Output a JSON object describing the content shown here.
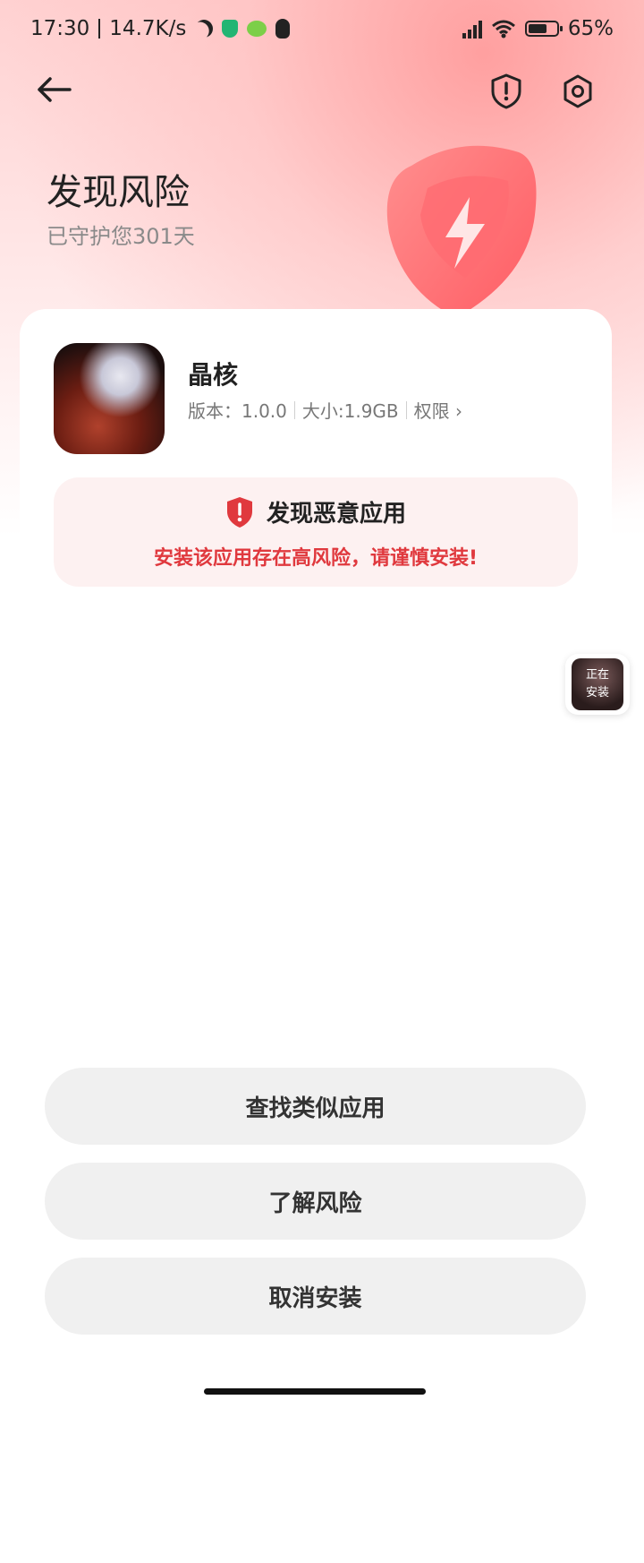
{
  "status_bar": {
    "time": "17:30",
    "net_speed": "14.7K/s",
    "battery": "65%",
    "icons": [
      "moon-icon",
      "shield-icon",
      "wechat-icon",
      "qq-icon",
      "hd-signal-icon",
      "wifi-icon",
      "battery-icon"
    ]
  },
  "header": {
    "back_icon": "arrow-left-icon",
    "right_icons": [
      "shield-alert-icon",
      "settings-gear-icon"
    ]
  },
  "hero": {
    "title": "发现风险",
    "subtitle": "已守护您301天"
  },
  "app": {
    "name": "晶核",
    "version": "版本：1.0.0",
    "size": "大小:1.9GB",
    "permissions": "权限"
  },
  "warning": {
    "title": "发现恶意应用",
    "description": "安装该应用存在高风险，请谨慎安装!",
    "color": "#e0393e"
  },
  "floating": {
    "line1": "正在",
    "line2": "安装"
  },
  "actions": {
    "find_similar": "查找类似应用",
    "learn_risk": "了解风险",
    "cancel_install": "取消安装"
  },
  "colors": {
    "accent_red": "#e0393e",
    "warn_bg": "#fdf1f1",
    "button_bg": "#f0f0f0"
  }
}
